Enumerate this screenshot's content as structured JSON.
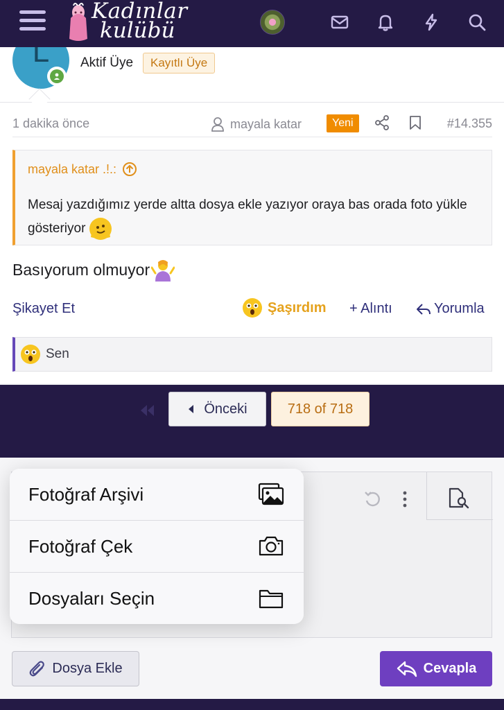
{
  "header": {
    "logo_line1": "Kadınlar",
    "logo_line2": "kulübü",
    "icons": [
      "menu-icon",
      "avatar",
      "envelope-icon",
      "bell-icon",
      "bolt-icon",
      "search-icon"
    ]
  },
  "author": {
    "avatar_letter": "L",
    "title": "Aktif Üye",
    "badge": "Kayıtlı Üye"
  },
  "post": {
    "time": "1 dakika önce",
    "op_name": "mayala katar",
    "new_label": "Yeni",
    "number": "#14.355",
    "quote": {
      "author": "mayala katar .!.:",
      "text": "Mesaj yazdığımız yerde altta dosya ekle yazıyor oraya bas orada foto yükle gösteriyor"
    },
    "text": "Basıyorum olmuyor",
    "actions": {
      "report": "Şikayet Et",
      "reaction": "Şaşırdım",
      "quote": "+ Alıntı",
      "comment": "Yorumla"
    },
    "reactions_summary": "Sen"
  },
  "pagination": {
    "prev_label": "Önceki",
    "current": "718 of 718"
  },
  "reply": {
    "attach_label": "Dosya Ekle",
    "submit_label": "Cevapla"
  },
  "popup_menu": {
    "items": [
      {
        "label": "Fotoğraf Arşivi",
        "icon": "photo-library-icon"
      },
      {
        "label": "Fotoğraf Çek",
        "icon": "camera-icon"
      },
      {
        "label": "Dosyaları Seçin",
        "icon": "folder-icon"
      }
    ]
  },
  "colors": {
    "brand_dark": "#241a45",
    "accent_purple": "#6e3fc0",
    "accent_orange": "#f08c00",
    "link": "#2f2f7a"
  }
}
